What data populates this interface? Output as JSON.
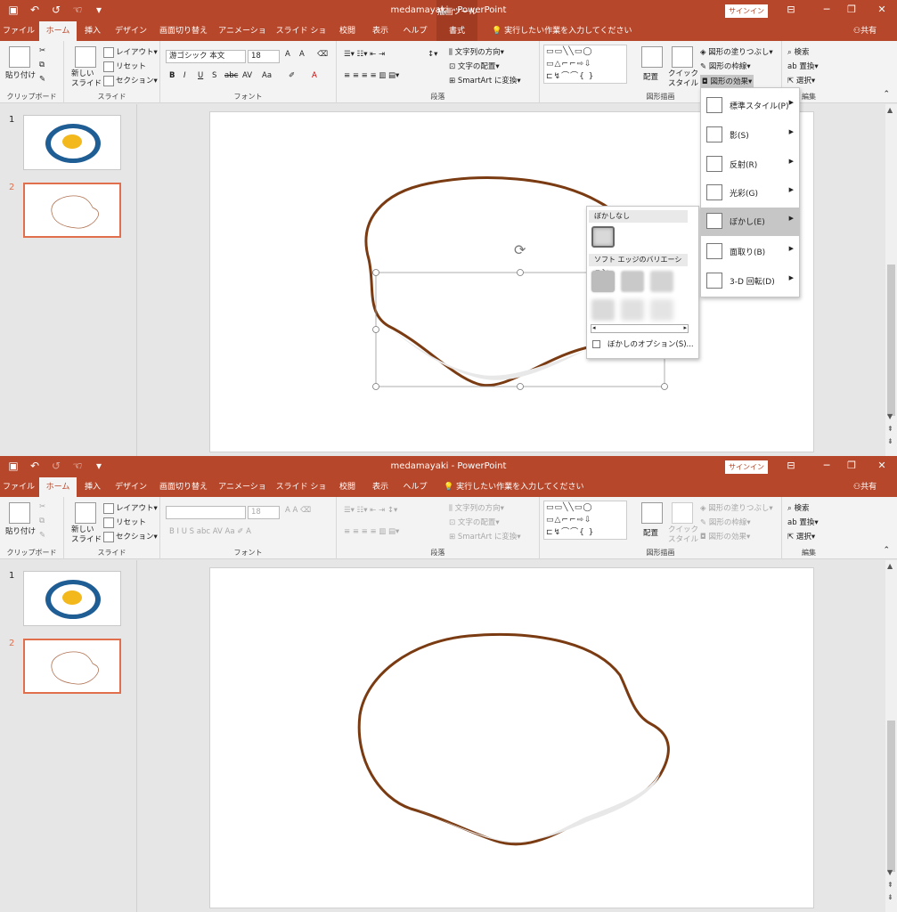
{
  "windows": [
    {
      "title": "medamayaki  -  PowerPoint",
      "context_tab_group": "描画ツール",
      "signin": "サインイン",
      "tabs": [
        "ファイル",
        "ホーム",
        "挿入",
        "デザイン",
        "画面切り替え",
        "アニメーション",
        "スライド ショー",
        "校閲",
        "表示",
        "ヘルプ",
        "書式"
      ],
      "active_tab": "ホーム",
      "tell_me": "実行したい作業を入力してください",
      "share": "共有",
      "ribbon": {
        "clipboard": {
          "paste": "貼り付け",
          "label": "クリップボード"
        },
        "slides": {
          "new_slide": "新しい\nスライド",
          "layout": "レイアウト",
          "reset": "リセット",
          "section": "セクション",
          "label": "スライド"
        },
        "font": {
          "name": "游ゴシック 本文",
          "size": "18",
          "bold": "B",
          "italic": "I",
          "underline": "U",
          "shadow": "S",
          "strike": "abc",
          "spacing": "AV",
          "case": "Aa",
          "grow": "A",
          "shrink": "A",
          "color": "A",
          "label": "フォント"
        },
        "paragraph": {
          "text_direction": "文字列の方向",
          "align_text": "文字の配置",
          "smartart": "SmartArt に変換",
          "label": "段落"
        },
        "drawing": {
          "arrange": "配置",
          "quick_styles": "クイック\nスタイル",
          "shape_fill": "図形の塗りつぶし",
          "shape_outline": "図形の枠線",
          "shape_effects": "図形の効果",
          "label": "図形描画"
        },
        "editing": {
          "find": "検索",
          "replace": "置換",
          "select": "選択",
          "label": "編集"
        }
      },
      "slides": [
        {
          "number": "1"
        },
        {
          "number": "2"
        }
      ],
      "effects_menu": {
        "items": [
          {
            "label": "標準スタイル(P)"
          },
          {
            "label": "影(S)"
          },
          {
            "label": "反射(R)"
          },
          {
            "label": "光彩(G)"
          },
          {
            "label": "ぼかし(E)",
            "highlighted": true
          },
          {
            "label": "面取り(B)"
          },
          {
            "label": "3-D 回転(D)"
          }
        ]
      },
      "soft_edges_menu": {
        "no_blur": "ぼかしなし",
        "variations": "ソフト エッジのバリエーション",
        "options": "ぼかしのオプション(S)..."
      }
    },
    {
      "title": "medamayaki  -  PowerPoint",
      "signin": "サインイン",
      "tabs": [
        "ファイル",
        "ホーム",
        "挿入",
        "デザイン",
        "画面切り替え",
        "アニメーション",
        "スライド ショー",
        "校閲",
        "表示",
        "ヘルプ"
      ],
      "active_tab": "ホーム",
      "tell_me": "実行したい作業を入力してください",
      "share": "共有",
      "ribbon": {
        "clipboard": {
          "paste": "貼り付け",
          "label": "クリップボード"
        },
        "slides": {
          "new_slide": "新しい\nスライド",
          "layout": "レイアウト",
          "reset": "リセット",
          "section": "セクション",
          "label": "スライド"
        },
        "font": {
          "name": "",
          "size": "18",
          "label": "フォント"
        },
        "paragraph": {
          "text_direction": "文字列の方向",
          "align_text": "文字の配置",
          "smartart": "SmartArt に変換",
          "label": "段落"
        },
        "drawing": {
          "arrange": "配置",
          "quick_styles": "クイック\nスタイル",
          "shape_fill": "図形の塗りつぶし",
          "shape_outline": "図形の枠線",
          "shape_effects": "図形の効果",
          "label": "図形描画"
        },
        "editing": {
          "find": "検索",
          "replace": "置換",
          "select": "選択",
          "label": "編集"
        }
      },
      "slides": [
        {
          "number": "1"
        },
        {
          "number": "2"
        }
      ]
    }
  ],
  "colors": {
    "titlebar": "#b7472a",
    "context": "#a13b22",
    "egg_outline": "#7a3b12",
    "plate": "#1f5d95",
    "yolk": "#f2b81c",
    "selection": "#e0704d"
  }
}
